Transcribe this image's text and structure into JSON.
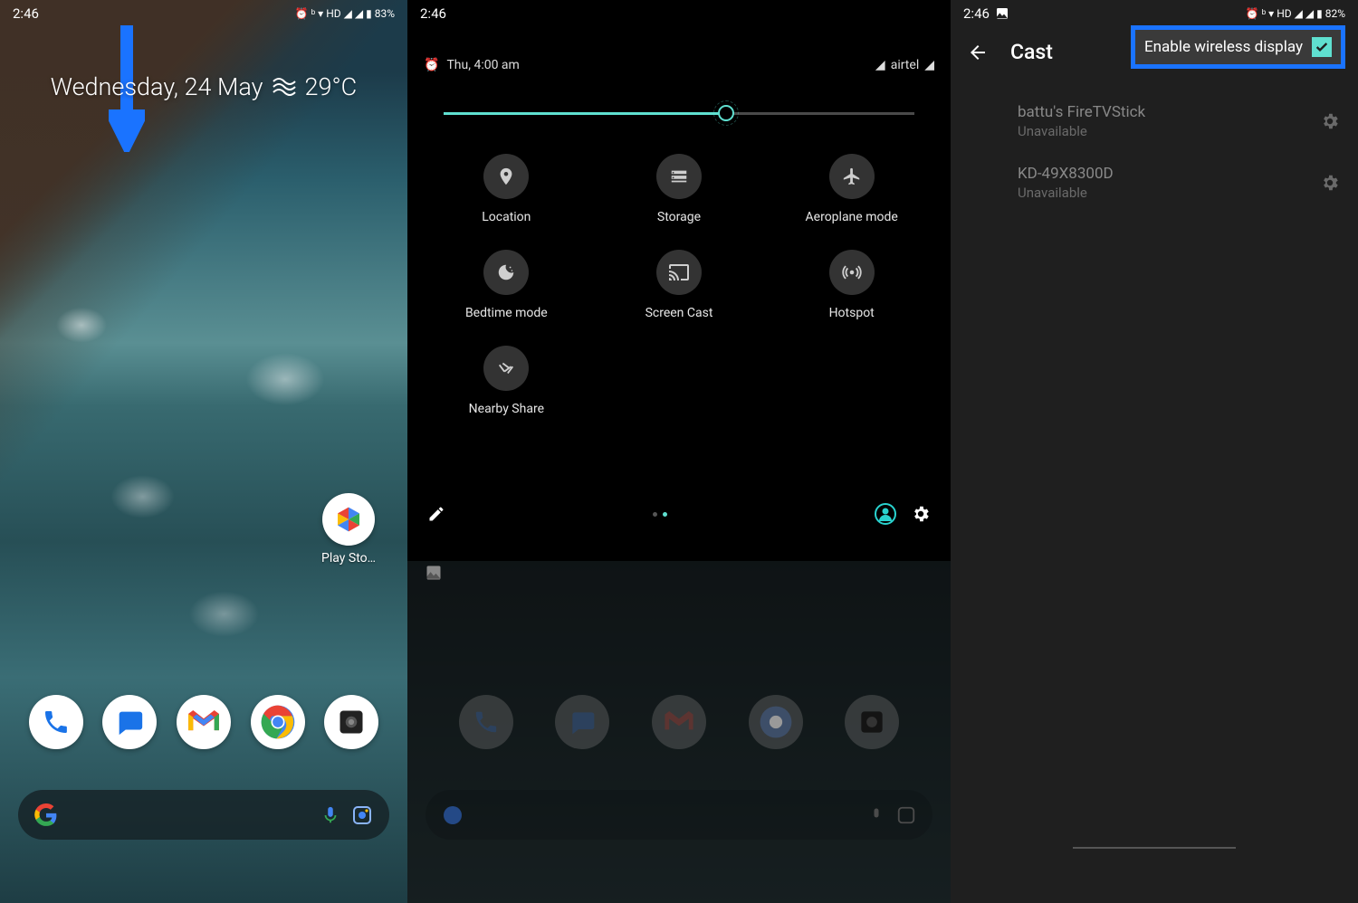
{
  "colors": {
    "highlight": "#1a73ff",
    "teal": "#5fe0d0"
  },
  "panel1": {
    "status": {
      "time": "2:46",
      "battery": "83%",
      "hd": "HD"
    },
    "date": "Wednesday, 24 May",
    "temp": "29°C",
    "playStoreLabel": "Play Sto…"
  },
  "panel2": {
    "status": {
      "time": "2:46"
    },
    "qsHeader": {
      "date": "Thu, 4:00 am",
      "carrier": "airtel"
    },
    "brightnessPercent": 60,
    "tiles": [
      {
        "id": "location",
        "label": "Location"
      },
      {
        "id": "storage",
        "label": "Storage"
      },
      {
        "id": "aeroplane",
        "label": "Aeroplane mode"
      },
      {
        "id": "bedtime",
        "label": "Bedtime mode"
      },
      {
        "id": "screencast",
        "label": "Screen Cast"
      },
      {
        "id": "hotspot",
        "label": "Hotspot"
      },
      {
        "id": "nearbyshare",
        "label": "Nearby Share"
      }
    ]
  },
  "panel3": {
    "status": {
      "time": "2:46",
      "battery": "82%",
      "hd": "HD"
    },
    "title": "Cast",
    "enableLabel": "Enable wireless display",
    "enableChecked": true,
    "devices": [
      {
        "name": "battu's FireTVStick",
        "status": "Unavailable"
      },
      {
        "name": "KD-49X8300D",
        "status": "Unavailable"
      }
    ]
  }
}
